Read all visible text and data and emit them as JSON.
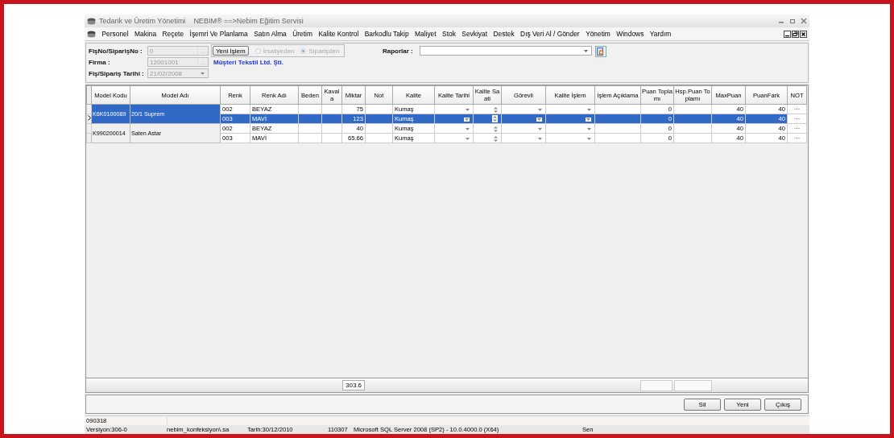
{
  "window": {
    "title": "Tedarik ve Üretim Yönetimi",
    "subtitle": "NEBIM® ==>Nebim Eğitim Servisi"
  },
  "menu": [
    "Personel",
    "Makina",
    "Reçete",
    "İşemri Ve Planlama",
    "Satın Alma",
    "Üretim",
    "Kalite Kontrol",
    "Barkodlu Takip",
    "Maliyet",
    "Stok",
    "Sevkiyat",
    "Destek",
    "Dış Veri Al / Gönder",
    "Yönetim",
    "Windows",
    "Yardım"
  ],
  "form": {
    "fis_no_label": "FişNo/SiparişNo :",
    "fis_no_value": "0",
    "new_button": "Yeni İşlem",
    "source_options": [
      {
        "label": "İrsaliyeden",
        "selected": false
      },
      {
        "label": "Siparişden",
        "selected": true
      }
    ],
    "firma_label": "Firma :",
    "firma_value": "12001001",
    "firma_name": "Müşteri Tekstil Ltd. Şti.",
    "date_label": "Fiş/Sipariş Tarihi :",
    "date_value": "21/02/2008",
    "reports_label": "Raporlar :",
    "browse_button": "..."
  },
  "table": {
    "columns": [
      {
        "label": "Model Kodu",
        "kind": "model"
      },
      {
        "label": "Model Adı",
        "kind": "model"
      },
      {
        "label": "Renk",
        "kind": "text"
      },
      {
        "label": "Renk Adı",
        "kind": "text"
      },
      {
        "label": "Beden",
        "kind": "text"
      },
      {
        "label": "Kavala",
        "kind": "text"
      },
      {
        "label": "Miktar",
        "kind": "num"
      },
      {
        "label": "Not",
        "kind": "text"
      },
      {
        "label": "Kalite",
        "kind": "text"
      },
      {
        "label": "Kalite Tarihi",
        "kind": "combo"
      },
      {
        "label": "Kalite Saati",
        "kind": "spin"
      },
      {
        "label": "Görevli",
        "kind": "combo"
      },
      {
        "label": "Kalite İşlem",
        "kind": "combo"
      },
      {
        "label": "İşlem Açıklama",
        "kind": "text"
      },
      {
        "label": "Puan Toplamı",
        "kind": "num"
      },
      {
        "label": "Hsp.Puan Toplamı",
        "kind": "num"
      },
      {
        "label": "MaxPuan",
        "kind": "num"
      },
      {
        "label": "PuanFark",
        "kind": "num"
      },
      {
        "label": "NOT",
        "kind": "more"
      }
    ],
    "groups": [
      {
        "model_code": "K6K0100089",
        "model_name": "20/1 Suprem",
        "selected": true,
        "rows": [
          {
            "renk": "002",
            "renk_adi": "BEYAZ",
            "miktar": "75",
            "kalite": "Kumaş",
            "puan_toplami": "0",
            "max_puan": "40",
            "puan_fark": "40",
            "not_button": "···",
            "selected": false
          },
          {
            "renk": "003",
            "renk_adi": "MAVİ",
            "miktar": "123",
            "kalite": "Kumaş",
            "puan_toplami": "0",
            "max_puan": "40",
            "puan_fark": "40",
            "not_button": "···",
            "selected": true
          }
        ]
      },
      {
        "model_code": "K990200014",
        "model_name": "Saten Astar",
        "selected": false,
        "rows": [
          {
            "renk": "002",
            "renk_adi": "BEYAZ",
            "miktar": "40",
            "kalite": "Kumaş",
            "puan_toplami": "0",
            "max_puan": "40",
            "puan_fark": "40",
            "not_button": "···",
            "selected": false
          },
          {
            "renk": "003",
            "renk_adi": "MAVİ",
            "miktar": "65.66",
            "kalite": "Kumaş",
            "puan_toplami": "0",
            "max_puan": "40",
            "puan_fark": "40",
            "not_button": "···",
            "selected": false
          }
        ]
      }
    ],
    "footer": {
      "miktar_total": "303.6"
    }
  },
  "buttons": [
    "Sil",
    "Yeni",
    "Çıkış"
  ],
  "status_bar": {
    "line1": [
      "090318"
    ],
    "line2": [
      "Versiyon:306-0",
      "nebim_konfeksiyon\\.sa",
      "Tarih:30/12/2010",
      "110307",
      "Microsoft SQL Server 2008 (SP2) - 10.0.4000.0 (X64)",
      "Sen"
    ]
  }
}
